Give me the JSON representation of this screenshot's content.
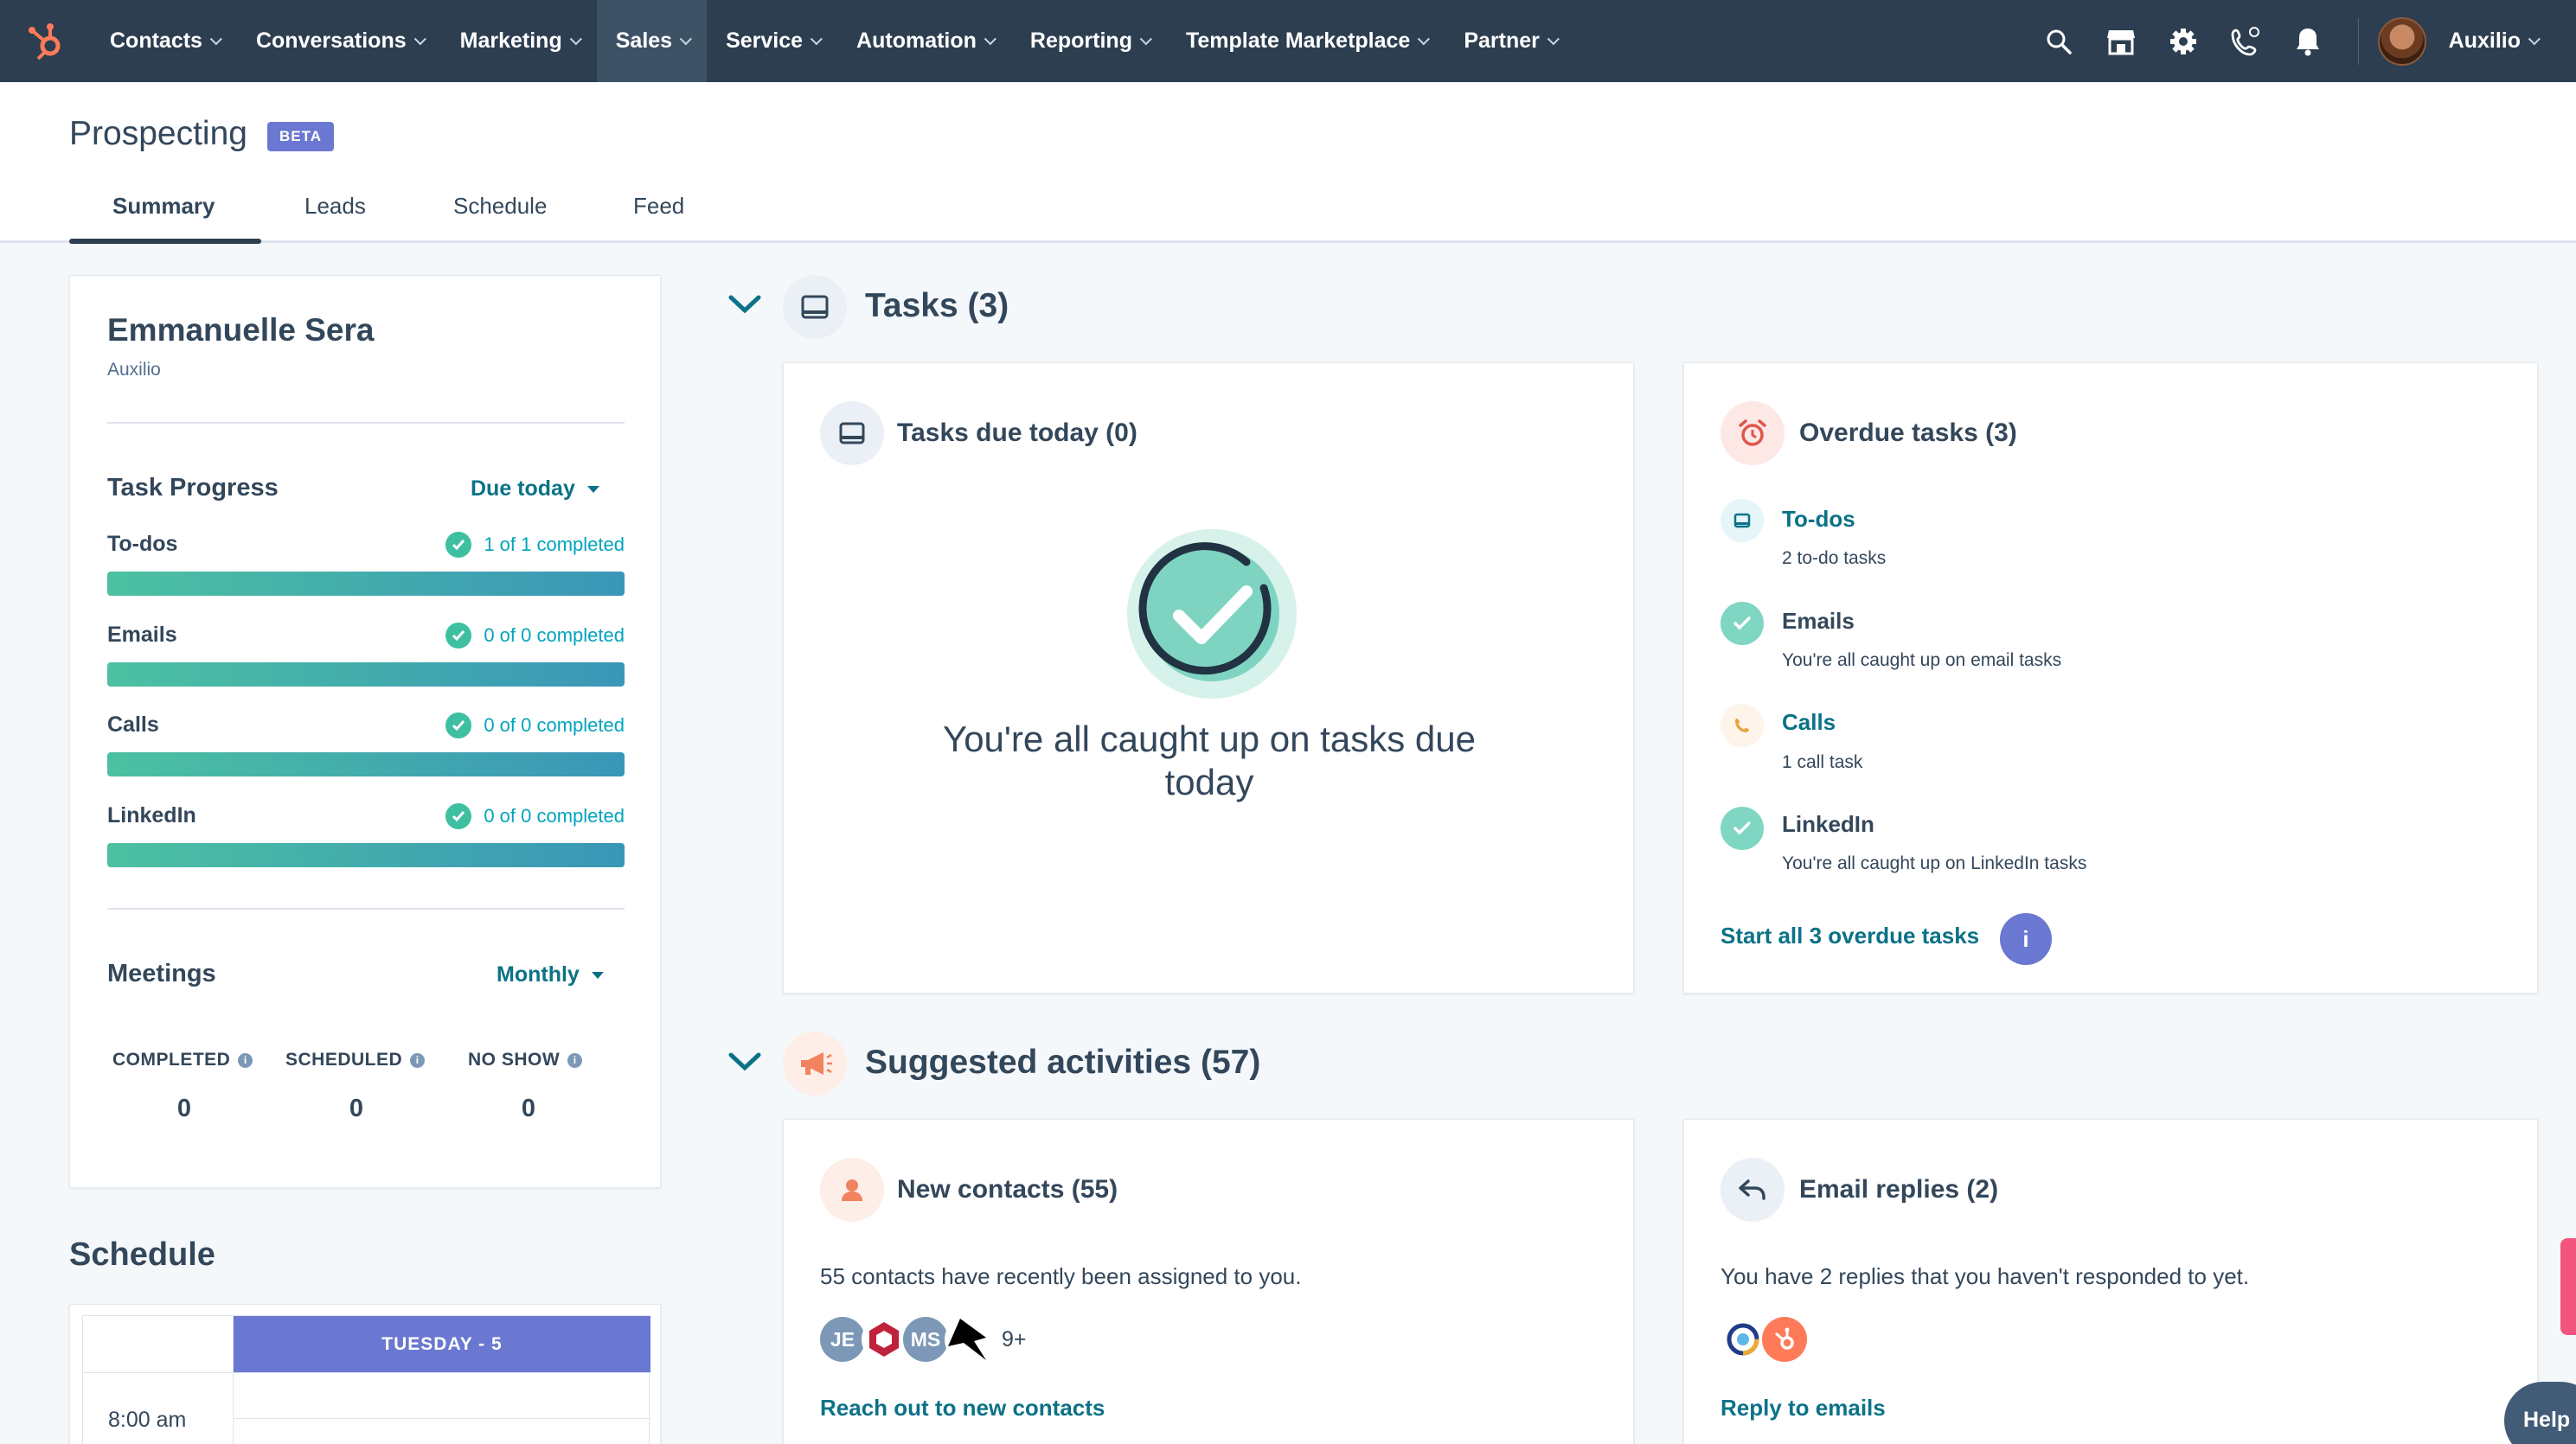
{
  "nav": {
    "items": [
      "Contacts",
      "Conversations",
      "Marketing",
      "Sales",
      "Service",
      "Automation",
      "Reporting",
      "Template Marketplace",
      "Partner"
    ],
    "active": "Sales",
    "account_name": "Auxilio"
  },
  "header": {
    "title": "Prospecting",
    "badge": "BETA",
    "tabs": [
      "Summary",
      "Leads",
      "Schedule",
      "Feed"
    ],
    "active_tab": "Summary"
  },
  "profile": {
    "name": "Emmanuelle Sera",
    "company": "Auxilio"
  },
  "task_progress": {
    "title": "Task Progress",
    "filter": "Due today",
    "rows": [
      {
        "label": "To-dos",
        "status": "1 of 1 completed",
        "progress": 1.0
      },
      {
        "label": "Emails",
        "status": "0 of 0 completed",
        "progress": 1.0
      },
      {
        "label": "Calls",
        "status": "0 of 0 completed",
        "progress": 1.0
      },
      {
        "label": "LinkedIn",
        "status": "0 of 0 completed",
        "progress": 1.0
      }
    ]
  },
  "meetings": {
    "title": "Meetings",
    "filter": "Monthly",
    "stats": [
      {
        "label": "COMPLETED",
        "value": "0"
      },
      {
        "label": "SCHEDULED",
        "value": "0"
      },
      {
        "label": "NO SHOW",
        "value": "0"
      }
    ]
  },
  "schedule": {
    "title": "Schedule",
    "day_header": "TUESDAY - 5",
    "first_time": "8:00 am"
  },
  "tasks_section": {
    "title": "Tasks (3)",
    "due_today": {
      "title": "Tasks due today (0)",
      "empty_message": "You're all caught up on tasks due today"
    },
    "overdue": {
      "title": "Overdue tasks (3)",
      "items": [
        {
          "label": "To-dos",
          "sub": "2 to-do tasks"
        },
        {
          "label": "Emails",
          "sub": "You're all caught up on email tasks"
        },
        {
          "label": "Calls",
          "sub": "1 call task"
        },
        {
          "label": "LinkedIn",
          "sub": "You're all caught up on LinkedIn tasks"
        }
      ],
      "action": "Start all 3 overdue tasks",
      "info_glyph": "i"
    }
  },
  "suggested_section": {
    "title": "Suggested activities (57)",
    "new_contacts": {
      "title": "New contacts (55)",
      "text": "55 contacts have recently been assigned to you.",
      "avatars": [
        "JE",
        "MS"
      ],
      "more": "9+",
      "action": "Reach out to new contacts"
    },
    "email_replies": {
      "title": "Email replies (2)",
      "text": "You have 2 replies that you haven't responded to yet.",
      "action": "Reply to emails"
    }
  },
  "help_label": "Help",
  "colors": {
    "nav_bg": "#2d3e50",
    "accent_link": "#0b7287",
    "beta_badge": "#6a78d1",
    "progress_start": "#4cc1a1",
    "progress_end": "#3a96b8",
    "success": "#3fbfa1",
    "hubspot_orange": "#ff7a59"
  }
}
